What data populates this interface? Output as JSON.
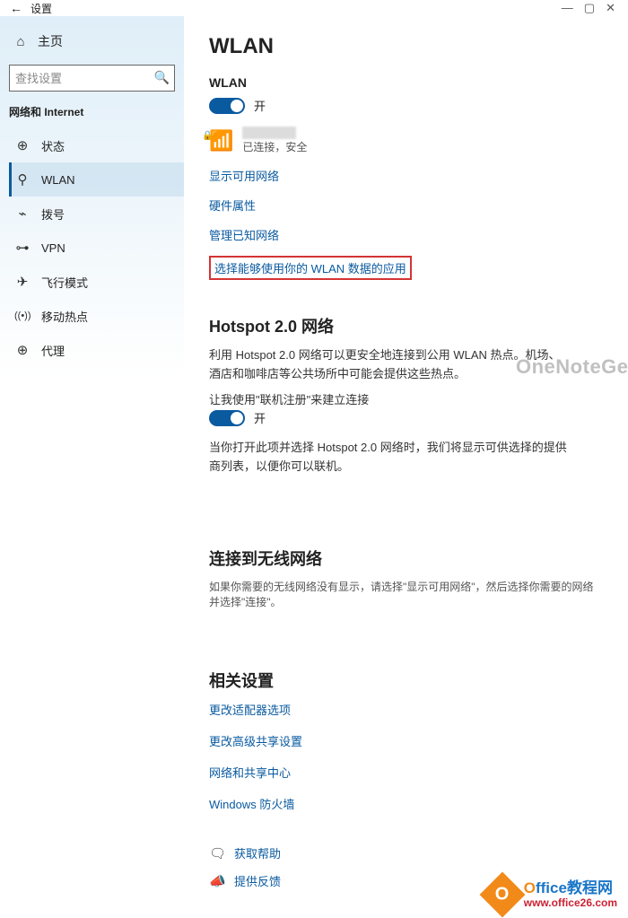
{
  "titlebar": {
    "app_name": "设置"
  },
  "sidebar": {
    "home_label": "主页",
    "search_placeholder": "查找设置",
    "section_label": "网络和 Internet",
    "items": [
      {
        "icon": "⊕",
        "label": "状态"
      },
      {
        "icon": "⚲",
        "label": "WLAN"
      },
      {
        "icon": "⌁",
        "label": "拨号"
      },
      {
        "icon": "⊶",
        "label": "VPN"
      },
      {
        "icon": "✈",
        "label": "飞行模式"
      },
      {
        "icon": "((•))",
        "label": "移动热点"
      },
      {
        "icon": "⊕",
        "label": "代理"
      }
    ]
  },
  "content": {
    "page_title": "WLAN",
    "wlan_section": {
      "label": "WLAN",
      "toggle_state": "开",
      "connected_status": "已连接，安全"
    },
    "links": {
      "show_networks": "显示可用网络",
      "hw_props": "硬件属性",
      "manage_known": "管理已知网络",
      "choose_apps": "选择能够使用你的 WLAN 数据的应用"
    },
    "hotspot": {
      "title": "Hotspot 2.0 网络",
      "desc": "利用 Hotspot 2.0 网络可以更安全地连接到公用 WLAN 热点。机场、酒店和咖啡店等公共场所中可能会提供这些热点。",
      "toggle_label": "让我使用\"联机注册\"来建立连接",
      "toggle_state": "开",
      "note": "当你打开此项并选择 Hotspot 2.0 网络时，我们将显示可供选择的提供商列表，以便你可以联机。"
    },
    "connect": {
      "title": "连接到无线网络",
      "desc": "如果你需要的无线网络没有显示，请选择\"显示可用网络\"，然后选择你需要的网络并选择\"连接\"。"
    },
    "related": {
      "title": "相关设置",
      "items": [
        "更改适配器选项",
        "更改高级共享设置",
        "网络和共享中心",
        "Windows 防火墙"
      ]
    },
    "help": {
      "get_help": "获取帮助",
      "feedback": "提供反馈"
    }
  },
  "watermark": "OneNoteGem.com",
  "footer": {
    "line1_a": "O",
    "line1_b": "ffice教程网",
    "line2": "www.office26.com"
  }
}
